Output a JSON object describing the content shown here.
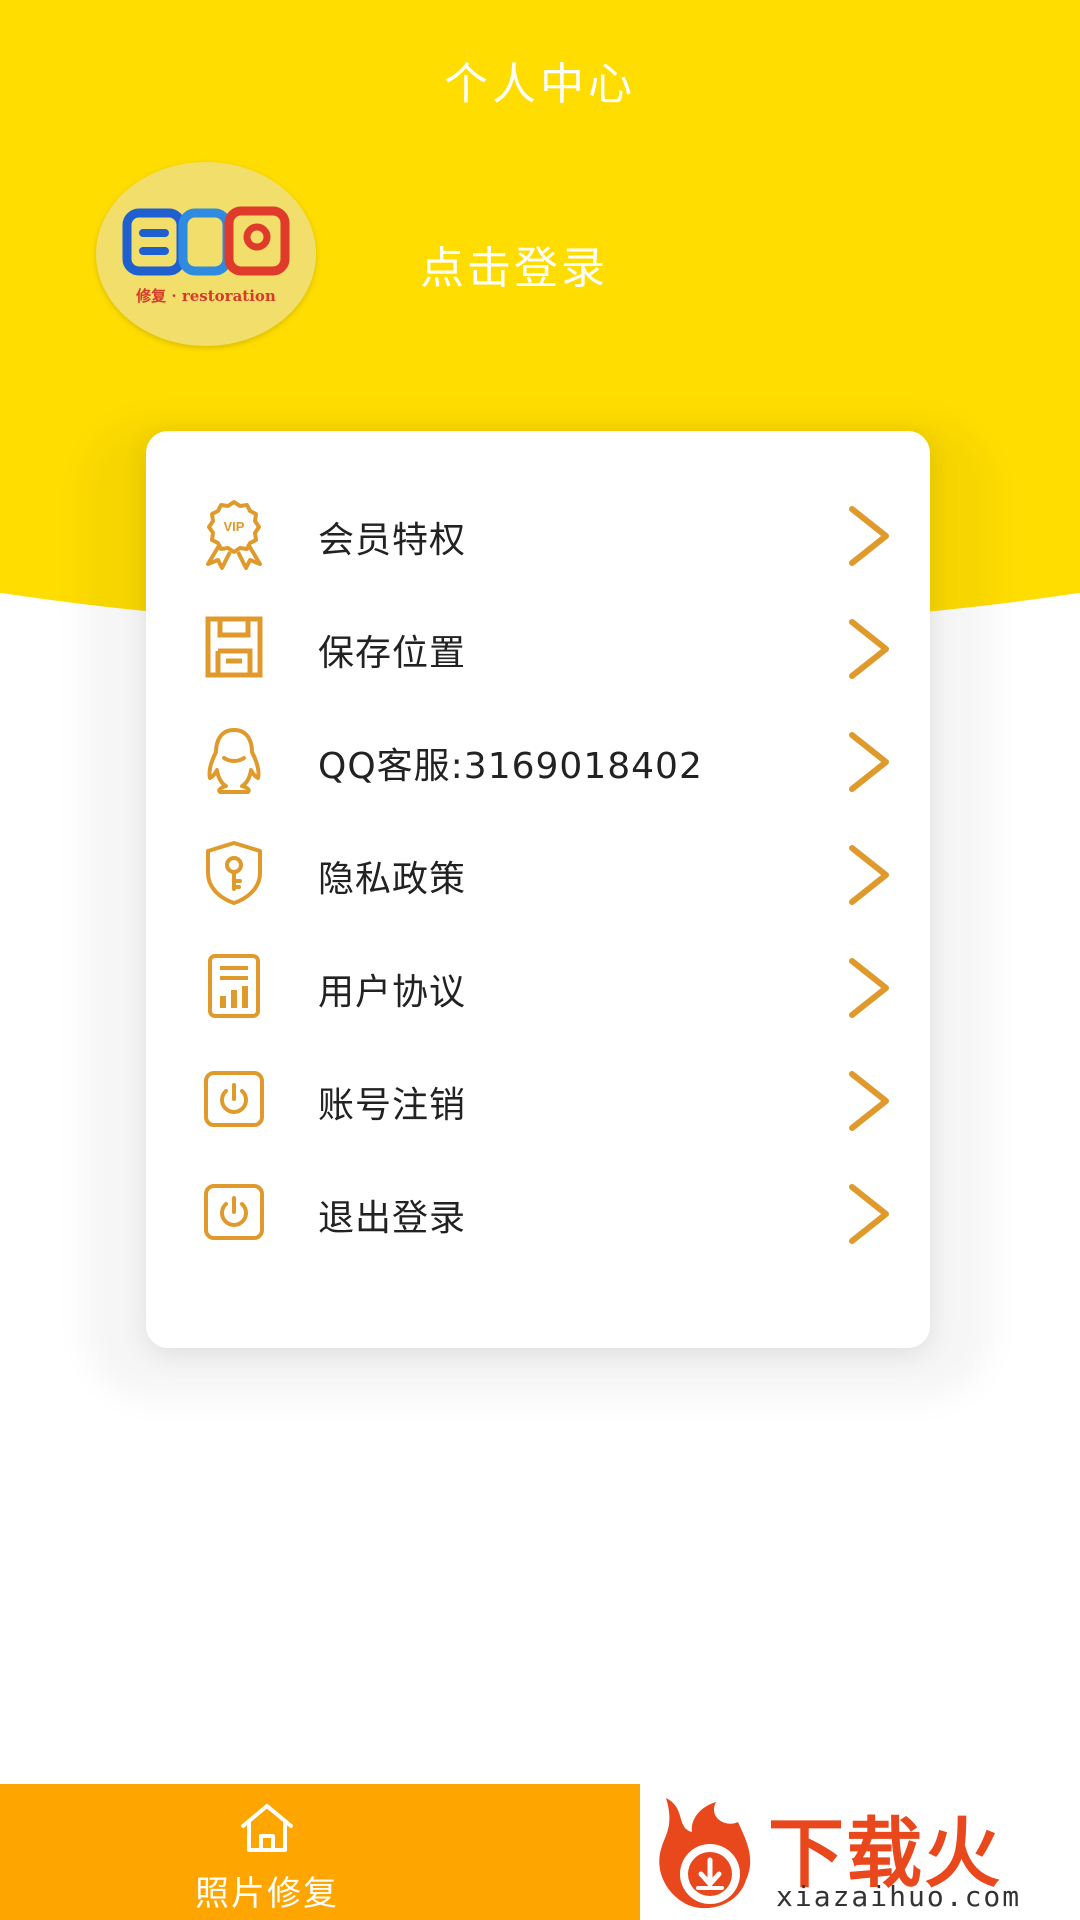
{
  "header": {
    "title": "个人中心",
    "login_prompt": "点击登录",
    "avatar_caption": "修复 · restoration"
  },
  "colors": {
    "header_yellow": "#FFDD00",
    "icon_orange": "#E09A2C",
    "bottom_bar": "#FFA500"
  },
  "menu": {
    "items": [
      {
        "label": "会员特权",
        "icon": "vip-badge-icon"
      },
      {
        "label": "保存位置",
        "icon": "floppy-disk-icon"
      },
      {
        "label": "QQ客服:3169018402",
        "icon": "qq-penguin-icon"
      },
      {
        "label": "隐私政策",
        "icon": "shield-key-icon"
      },
      {
        "label": "用户协议",
        "icon": "document-chart-icon"
      },
      {
        "label": "账号注销",
        "icon": "power-icon"
      },
      {
        "label": "退出登录",
        "icon": "power-icon"
      }
    ]
  },
  "bottom_nav": {
    "tab_label": "照片修复",
    "tab_icon": "home-icon"
  },
  "watermark": {
    "title": "下载火",
    "url": "xiazaihuo.com"
  }
}
